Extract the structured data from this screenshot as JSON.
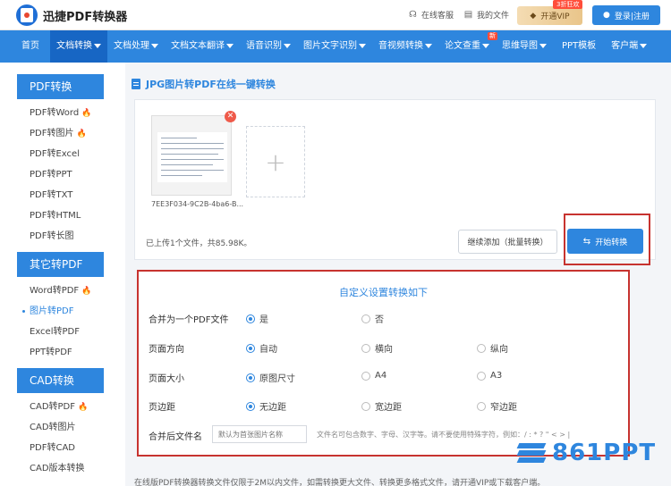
{
  "header": {
    "logo_text": "迅捷PDF转换器",
    "service_label": "在线客服",
    "my_files_label": "我的文件",
    "vip_label": "开通VIP",
    "vip_badge": "3折狂欢",
    "login_label": "登录|注册"
  },
  "nav": {
    "items": [
      "首页",
      "文档转换",
      "文档处理",
      "文档文本翻译",
      "语音识别",
      "图片文字识别",
      "音视频转换",
      "论文查重",
      "思维导图",
      "PPT模板",
      "客户端"
    ],
    "new_badge": "新"
  },
  "sidebar": {
    "pdf_convert": {
      "title": "PDF转换",
      "items": [
        "PDF转Word",
        "PDF转图片",
        "PDF转Excel",
        "PDF转PPT",
        "PDF转TXT",
        "PDF转HTML",
        "PDF转长图"
      ]
    },
    "other_to_pdf": {
      "title": "其它转PDF",
      "items": [
        "Word转PDF",
        "图片转PDF",
        "Excel转PDF",
        "PPT转PDF"
      ]
    },
    "cad_convert": {
      "title": "CAD转换",
      "items": [
        "CAD转PDF",
        "CAD转图片",
        "PDF转CAD",
        "CAD版本转换"
      ]
    }
  },
  "main": {
    "page_title": "JPG图片转PDF在线一键转换",
    "file_name": "7EE3F034-9C2B-4ba6-B...",
    "upload_info": "已上传1个文件，共85.98K。",
    "continue_label": "继续添加（批量转换）",
    "start_label": "开始转换"
  },
  "settings": {
    "title": "自定义设置转换如下",
    "merge": {
      "label": "合并为一个PDF文件",
      "options": [
        "是",
        "否"
      ]
    },
    "orientation": {
      "label": "页面方向",
      "options": [
        "自动",
        "横向",
        "纵向"
      ]
    },
    "size": {
      "label": "页面大小",
      "options": [
        "原图尺寸",
        "A4",
        "A3"
      ]
    },
    "margin": {
      "label": "页边距",
      "options": [
        "无边距",
        "宽边距",
        "窄边距"
      ]
    },
    "filename": {
      "label": "合并后文件名",
      "placeholder": "默认为首张图片名称",
      "hint": "文件名可包含数字、字母、汉字等。请不要使用特殊字符，例如：/ : * ? \" < > |"
    }
  },
  "bottom_text": "在线版PDF转换器转换文件仅限于2M以内文件，如需转换更大文件、转换更多格式文件，请开通VIP或下载客户端。",
  "watermark": "861PPT"
}
